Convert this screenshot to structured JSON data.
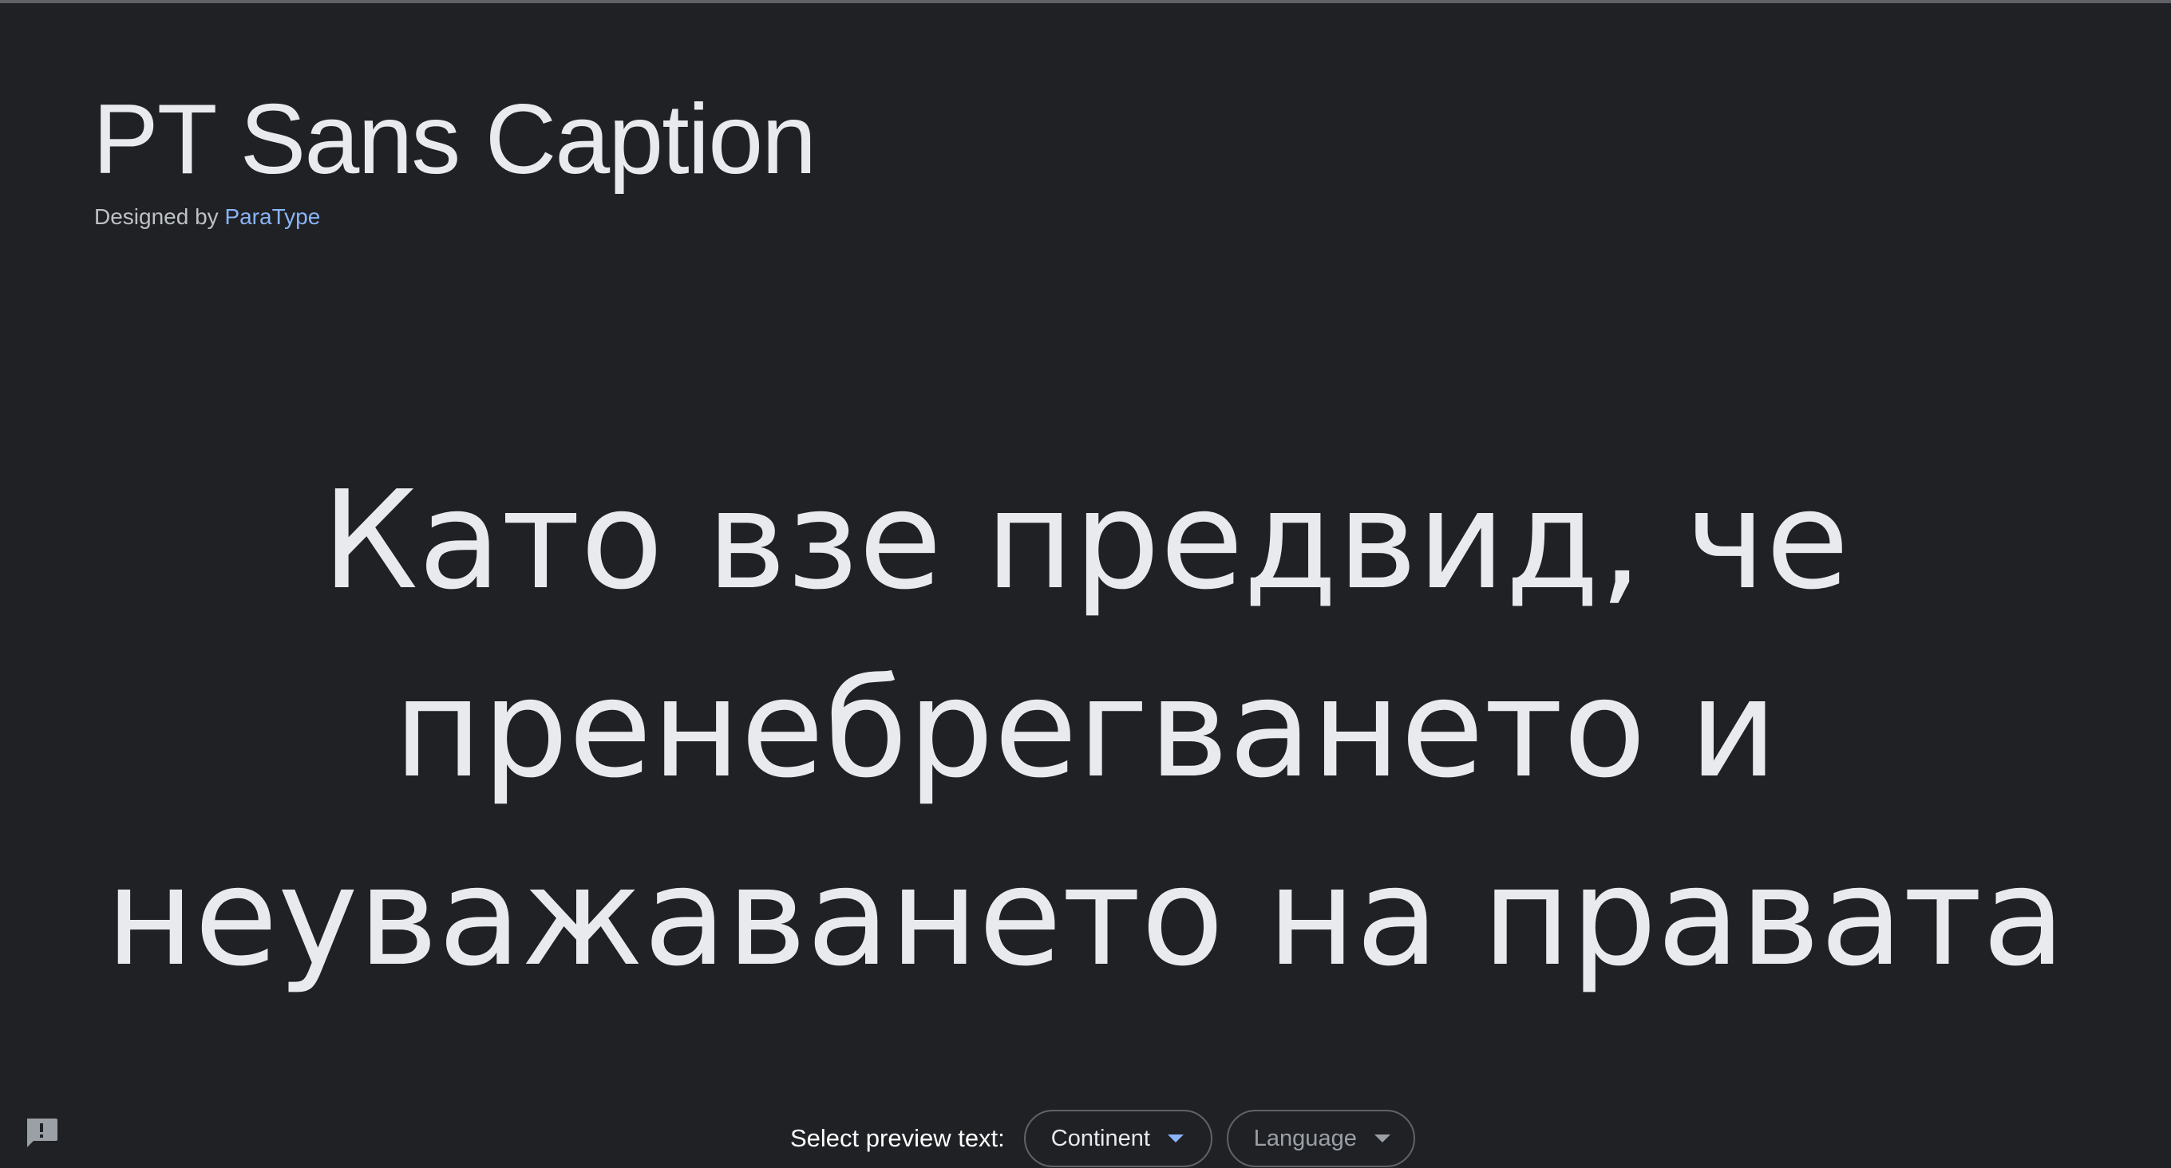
{
  "header": {
    "font_name": "PT Sans Caption",
    "designed_by_prefix": "Designed by",
    "designer": "ParaType"
  },
  "preview": {
    "lines": [
      "Като взе предвид, че",
      "пренебрегването и",
      "неуважаването на правата"
    ]
  },
  "controls": {
    "select_label": "Select preview text:",
    "continent_label": "Continent",
    "language_label": "Language"
  },
  "icons": {
    "feedback": "feedback-icon",
    "continent_caret": "caret-down-icon",
    "language_caret": "caret-down-icon"
  },
  "colors": {
    "background": "#202124",
    "text": "#e8eaed",
    "link": "#8ab4f8",
    "muted": "#9aa0a6",
    "border": "#5f6368"
  }
}
